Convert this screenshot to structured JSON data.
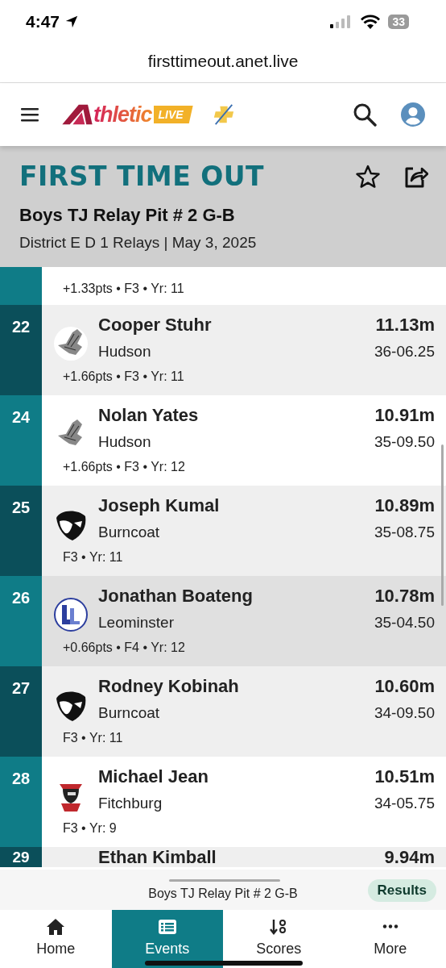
{
  "status_bar": {
    "time": "4:47",
    "battery": "33"
  },
  "url": "firsttimeout.anet.live",
  "header": {
    "logo_text": "thletic",
    "logo_badge": "LIVE"
  },
  "event": {
    "meet": "FIRST TIME OUT",
    "title": "Boys TJ Relay Pit # 2 G-B",
    "subtitle": "District E D 1 Relays | May 3, 2025",
    "favorite": false
  },
  "partial_row": {
    "detail": "+1.33pts • F3 • Yr: 11"
  },
  "rows": [
    {
      "place": "22",
      "kind": "eagle",
      "name": "Cooper Stuhr",
      "team": "Hudson",
      "metric": "11.13m",
      "imperial": "36-06.25",
      "detail": "+1.66pts • F3 • Yr: 11",
      "selected": false
    },
    {
      "place": "24",
      "kind": "eagle",
      "name": "Nolan Yates",
      "team": "Hudson",
      "metric": "10.91m",
      "imperial": "35-09.50",
      "detail": "+1.66pts • F3 • Yr: 12",
      "selected": false
    },
    {
      "place": "25",
      "kind": "mask",
      "name": "Joseph Kumal",
      "team": "Burncoat",
      "metric": "10.89m",
      "imperial": "35-08.75",
      "detail": "F3 • Yr: 11",
      "selected": false
    },
    {
      "place": "26",
      "kind": "crest",
      "name": "Jonathan Boateng",
      "team": "Leominster",
      "metric": "10.78m",
      "imperial": "35-04.50",
      "detail": "+0.66pts • F4 • Yr: 12",
      "selected": true
    },
    {
      "place": "27",
      "kind": "mask",
      "name": "Rodney Kobinah",
      "team": "Burncoat",
      "metric": "10.60m",
      "imperial": "34-09.50",
      "detail": "F3 • Yr: 11",
      "selected": false
    },
    {
      "place": "28",
      "kind": "knight",
      "name": "Michael Jean",
      "team": "Fitchburg",
      "metric": "10.51m",
      "imperial": "34-05.75",
      "detail": "F3 • Yr: 9",
      "selected": false
    }
  ],
  "bottom_row": {
    "place": "29",
    "name": "Ethan Kimball",
    "metric": "9.94m"
  },
  "mini_bar": {
    "title": "Boys TJ Relay Pit # 2 G-B",
    "button": "Results"
  },
  "tabs": [
    {
      "label": "Home",
      "kind": "home",
      "selected": false
    },
    {
      "label": "Events",
      "kind": "list",
      "selected": true
    },
    {
      "label": "Scores",
      "kind": "sort",
      "selected": false
    },
    {
      "label": "More",
      "kind": "more",
      "selected": false
    }
  ]
}
